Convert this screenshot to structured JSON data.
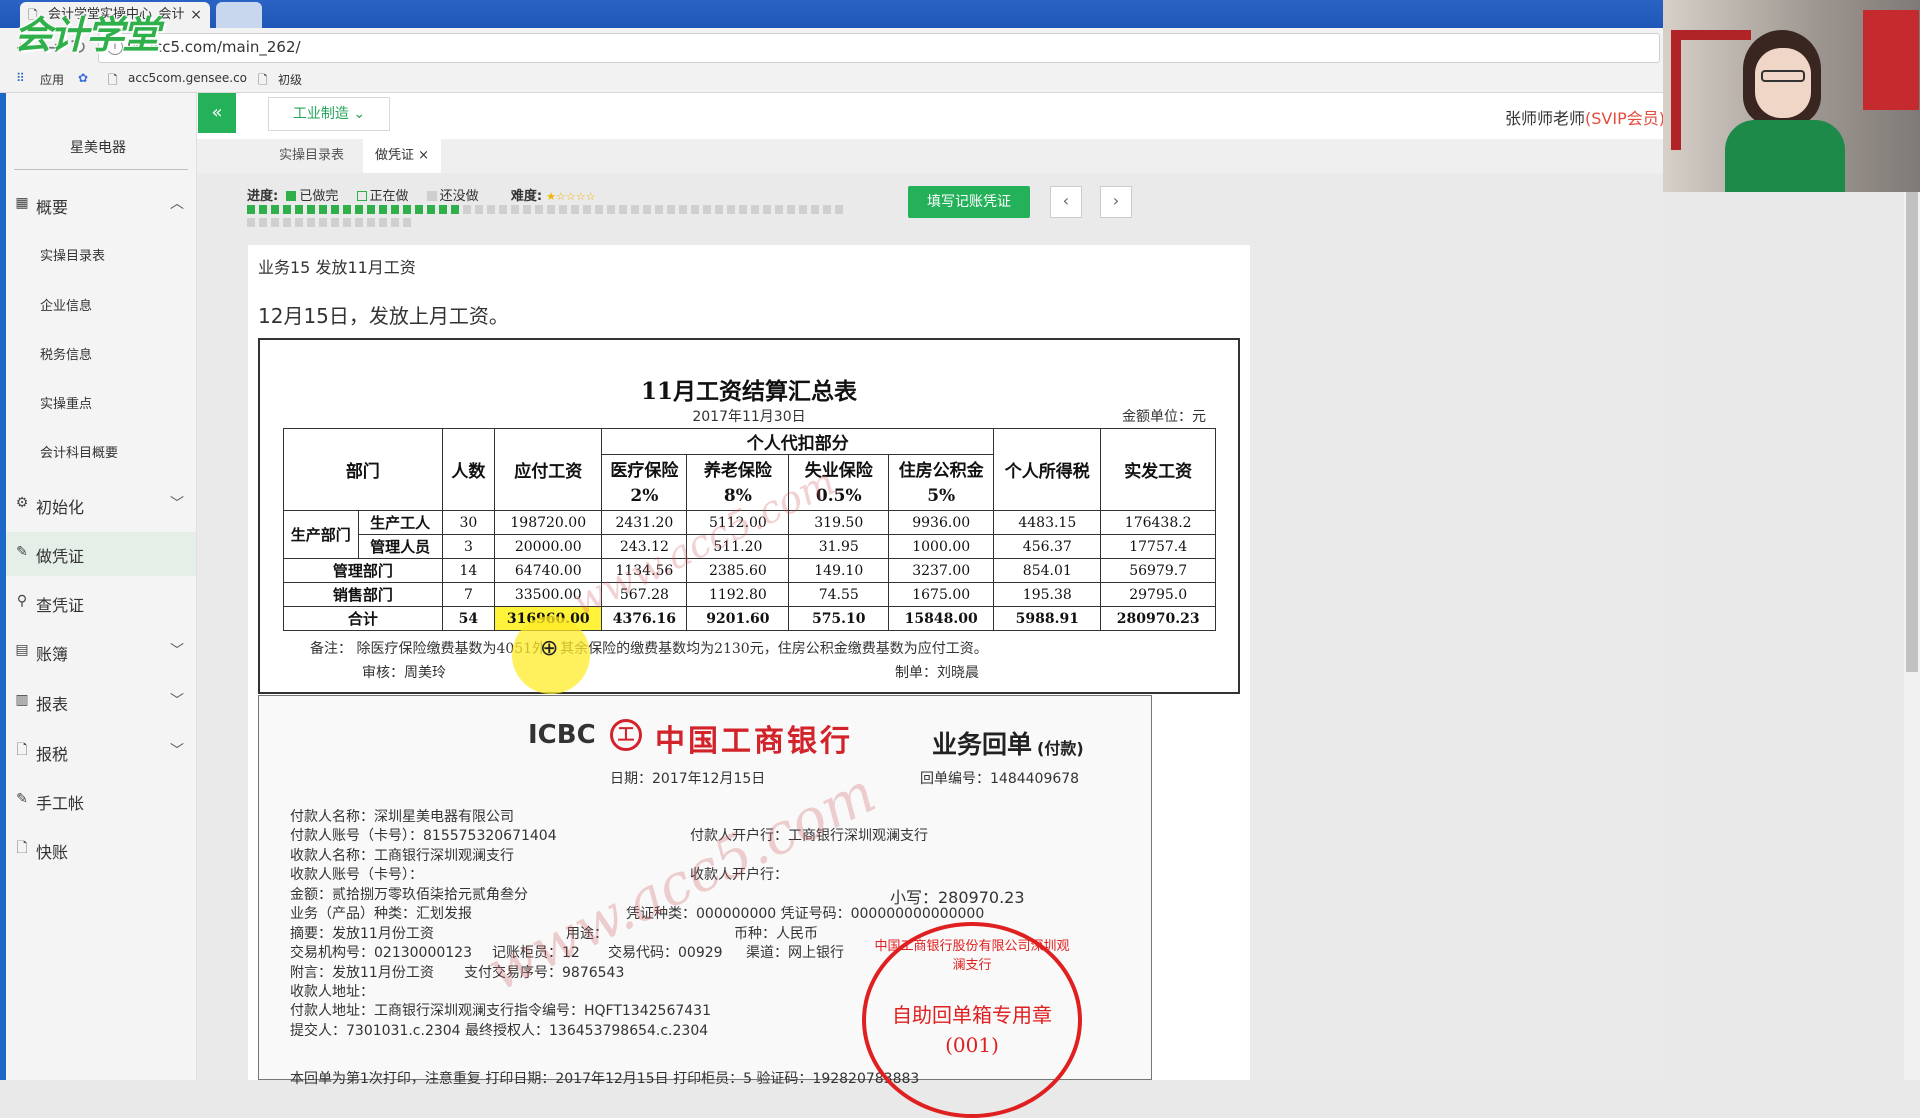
{
  "browser": {
    "tab_title": "会计学堂实操中心_会计",
    "tab_close": "×",
    "url": "lx.acc5.com/main_262/",
    "bookmarks": [
      "应用",
      "acc5com.gensee.co",
      "初级"
    ]
  },
  "logo_text": "会计学堂",
  "sidebar": {
    "company": "星美电器",
    "items": [
      {
        "label": "概要",
        "icon": "grid-icon",
        "chevron": "⌃"
      },
      {
        "label": "初始化",
        "icon": "gear-icon",
        "chevron": "⌄"
      },
      {
        "label": "做凭证",
        "icon": "pen-icon"
      },
      {
        "label": "查凭证",
        "icon": "search-icon"
      },
      {
        "label": "账簿",
        "icon": "book-icon",
        "chevron": "⌄"
      },
      {
        "label": "报表",
        "icon": "report-icon",
        "chevron": "⌄"
      },
      {
        "label": "报税",
        "icon": "file-icon",
        "chevron": "⌄"
      },
      {
        "label": "手工帐",
        "icon": "pen-icon"
      },
      {
        "label": "快账",
        "icon": "file-icon"
      }
    ],
    "sub_items": [
      "实操目录表",
      "企业信息",
      "税务信息",
      "实操重点",
      "会计科目概要"
    ]
  },
  "appbar": {
    "collapse": "«",
    "industry": "工业制造 ⌄",
    "user_name": "张师师老师",
    "user_level": "(SVIP会员)"
  },
  "content_tabs": [
    "实操目录表",
    "做凭证"
  ],
  "content_tab_close": "×",
  "progress": {
    "label": "进度:",
    "done": "已做完",
    "doing": "正在做",
    "todo": "还没做",
    "difficulty": "难度:",
    "stars": "★☆☆☆☆",
    "done_fraction": 0.28
  },
  "actions": {
    "fill_voucher": "填写记账凭证",
    "prev": "‹",
    "next": "›"
  },
  "business": {
    "title": "业务15 发放11月工资",
    "desc": "12月15日，发放上月工资。"
  },
  "salary_sheet": {
    "title": "11月工资结算汇总表",
    "date": "2017年11月30日",
    "unit": "金额单位：元",
    "headers": {
      "dept": "部门",
      "count": "人数",
      "payable": "应付工资",
      "personal_group": "个人代扣部分",
      "medical": "医疗保险",
      "medical_rate": "2%",
      "pension": "养老保险",
      "pension_rate": "8%",
      "unemployment": "失业保险",
      "unemployment_rate": "0.5%",
      "housing": "住房公积金",
      "housing_rate": "5%",
      "tax": "个人所得税",
      "actual": "实发工资"
    },
    "prod_dept": "生产部门",
    "rows": [
      {
        "name": "生产工人",
        "count": "30",
        "payable": "198720.00",
        "medical": "2431.20",
        "pension": "5112.00",
        "unemp": "319.50",
        "housing": "9936.00",
        "tax": "4483.15",
        "actual": "176438.2"
      },
      {
        "name": "管理人员",
        "count": "3",
        "payable": "20000.00",
        "medical": "243.12",
        "pension": "511.20",
        "unemp": "31.95",
        "housing": "1000.00",
        "tax": "456.37",
        "actual": "17757.4"
      },
      {
        "name": "管理部门",
        "count": "14",
        "payable": "64740.00",
        "medical": "1134.56",
        "pension": "2385.60",
        "unemp": "149.10",
        "housing": "3237.00",
        "tax": "854.01",
        "actual": "56979.7"
      },
      {
        "name": "销售部门",
        "count": "7",
        "payable": "33500.00",
        "medical": "567.28",
        "pension": "1192.80",
        "unemp": "74.55",
        "housing": "1675.00",
        "tax": "195.38",
        "actual": "29795.0"
      }
    ],
    "total": {
      "name": "合计",
      "count": "54",
      "payable": "316960.00",
      "medical": "4376.16",
      "pension": "9201.60",
      "unemp": "575.10",
      "housing": "15848.00",
      "tax": "5988.91",
      "actual": "280970.23"
    },
    "note": "备注： 除医疗保险缴费基数为4051外，其余保险的缴费基数均为2130元，住房公积金缴费基数为应付工资。",
    "audit": "审核：周美玲",
    "maker": "制单：刘晓晨"
  },
  "receipt": {
    "icbc": "ICBC",
    "icbc_mark": "工",
    "bank_name": "中国工商银行",
    "title": "业务回单",
    "subtitle": "(付款)",
    "date": "日期：2017年12月15日",
    "number": "回单编号：1484409678",
    "lines": [
      "付款人名称：深圳星美电器有限公司",
      "付款人账号（卡号）：815575320671404",
      "付款人开户行：工商银行深圳观澜支行",
      "收款人名称：工商银行深圳观澜支行",
      "收款人账号（卡号）：",
      "收款人开户行：",
      "金额：贰拾捌万零玖佰柒拾元贰角叁分",
      "小写：280970.23",
      "业务（产品）种类：汇划发报",
      "凭证种类：000000000 凭证号码：000000000000000",
      "摘要：发放11月份工资",
      "用途：",
      "币种：人民币",
      "交易机构号：02130000123",
      "记账柜员：12",
      "交易代码：00929",
      "渠道：网上银行",
      "附言：发放11月份工资",
      "支付交易序号：9876543",
      "收款人地址：",
      "付款人地址：工商银行深圳观澜支行指令编号：HQFT1342567431",
      "提交人：7301031.c.2304 最终授权人：136453798654.c.2304",
      "本回单为第1次打印，注意重复 打印日期：2017年12月15日 打印柜员：5 验证码：192820783883"
    ],
    "stamp_ring": "中国工商银行股份有限公司深圳观澜支行",
    "stamp_center": "自助回单箱专用章",
    "stamp_number": "(001)"
  },
  "watermark": "www.acc5.com",
  "colors": {
    "accent": "#25b05a",
    "brand_blue": "#1c68c7",
    "stamp_red": "#e02020",
    "highlight": "#fff23a",
    "vip": "#e34b3b"
  }
}
